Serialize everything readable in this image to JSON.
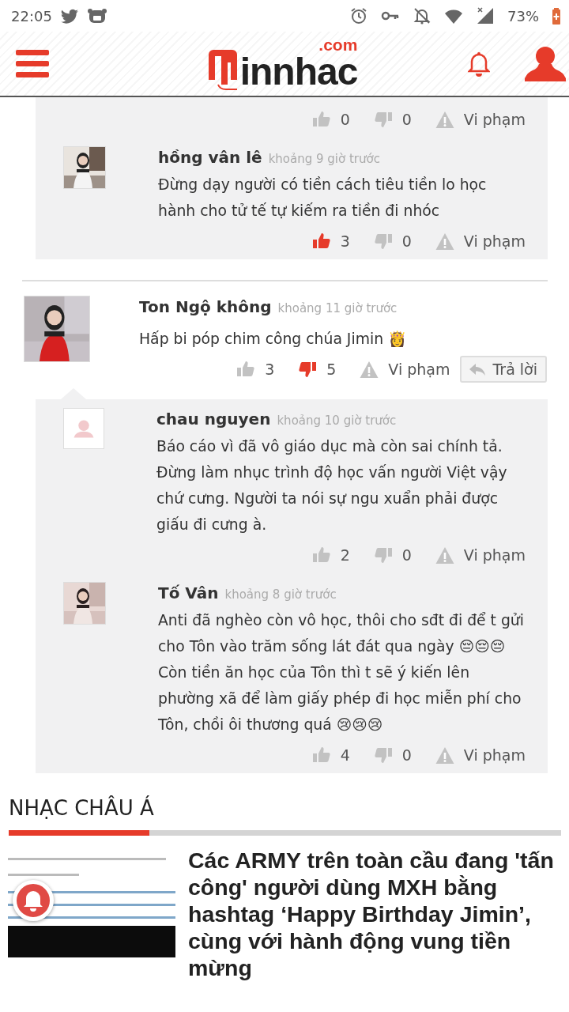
{
  "status_bar": {
    "time": "22:05",
    "battery": "73%"
  },
  "header": {
    "logo": "innhac",
    "domain": ".com"
  },
  "earlier_replies": [
    {
      "likes": "0",
      "liked": false,
      "dislikes": "0",
      "disliked": false,
      "report": "Vi phạm"
    },
    {
      "avatar": {
        "kind": "picture"
      },
      "name": "hồng vân lê",
      "time": "khoảng 9 giờ trước",
      "paragraphs": [
        "Đừng dạy người có tiền cách tiêu tiền lo học hành cho tử tế tự kiếm ra tiền đi nhóc"
      ],
      "likes": "3",
      "liked": true,
      "dislikes": "0",
      "disliked": false,
      "report": "Vi phạm"
    }
  ],
  "comment": {
    "avatar": {
      "kind": "picture"
    },
    "name": "Ton Ngộ không",
    "time": "khoảng 11 giờ trước",
    "paragraphs": [
      "Hấp bi póp chim công chúa Jimin 👸"
    ],
    "likes": "3",
    "liked": false,
    "dislikes": "5",
    "disliked": true,
    "report": "Vi phạm",
    "reply": "Trả lời"
  },
  "replies": [
    {
      "avatar": {
        "kind": "placeholder"
      },
      "name": "chau nguyen",
      "time": "khoảng 10 giờ trước",
      "paragraphs": [
        "Báo cáo vì đã vô giáo dục mà còn sai chính tả. Đừng làm nhục trình độ học vấn người Việt vậy chứ cưng. Người ta nói sự ngu xuẩn phải được giấu đi cưng à."
      ],
      "likes": "2",
      "liked": false,
      "dislikes": "0",
      "disliked": false,
      "report": "Vi phạm"
    },
    {
      "avatar": {
        "kind": "picture"
      },
      "name": "Tố Vân",
      "time": "khoảng 8 giờ trước",
      "paragraphs": [
        "Anti đã nghèo còn vô học, thôi cho sđt đi để t gửi cho Tôn vào trăm sống lát đát qua ngày 😔😔😔",
        "Còn tiền ăn học của Tôn thì t sẽ ý kiến lên phường xã để làm giấy phép đi học miễn phí cho Tôn, chồi ôi thương quá 😢😢😢"
      ],
      "likes": "4",
      "liked": false,
      "dislikes": "0",
      "disliked": false,
      "report": "Vi phạm"
    }
  ],
  "section": {
    "title": "NHẠC CHÂU Á"
  },
  "article": {
    "title": "Các ARMY trên toàn cầu đang 'tấn công' người dùng MXH bằng hashtag ‘Happy Birthday Jimin’, cùng với hành động vung tiền mừng"
  }
}
